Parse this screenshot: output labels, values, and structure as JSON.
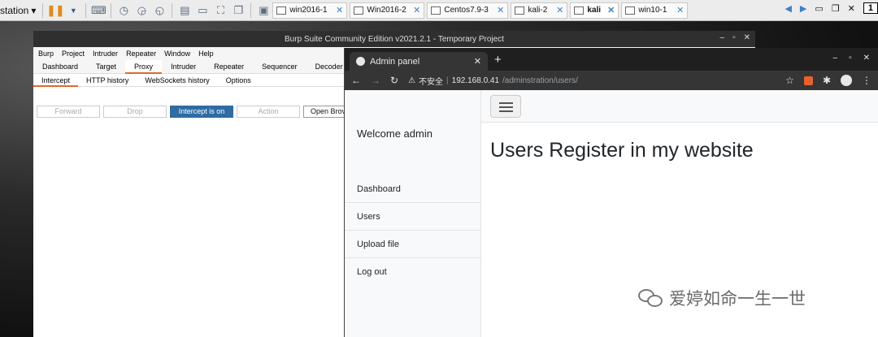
{
  "vmware": {
    "menu_label": "station",
    "tabs": [
      {
        "label": "win2016-1",
        "active": false
      },
      {
        "label": "Win2016-2",
        "active": false
      },
      {
        "label": "Centos7.9-3",
        "active": false
      },
      {
        "label": "kali-2",
        "active": false
      },
      {
        "label": "kali",
        "active": true
      },
      {
        "label": "win10-1",
        "active": false
      }
    ],
    "badge": "1"
  },
  "burp": {
    "title": "Burp Suite Community Edition v2021.2.1 - Temporary Project",
    "menu": [
      "Burp",
      "Project",
      "Intruder",
      "Repeater",
      "Window",
      "Help"
    ],
    "tabs": [
      "Dashboard",
      "Target",
      "Proxy",
      "Intruder",
      "Repeater",
      "Sequencer",
      "Decoder"
    ],
    "active_tab": "Proxy",
    "subtabs": [
      "Intercept",
      "HTTP history",
      "WebSockets history",
      "Options"
    ],
    "active_subtab": "Intercept",
    "buttons": {
      "forward": "Forward",
      "drop": "Drop",
      "intercept": "Intercept is on",
      "action": "Action",
      "open_browser": "Open Brov"
    }
  },
  "chrome": {
    "tab_title": "Admin panel",
    "security_label": "不安全",
    "url_host": "192.168.0.41",
    "url_path": "/adminstration/users/"
  },
  "page": {
    "welcome": "Welcome admin",
    "nav": [
      "Dashboard",
      "Users",
      "Upload file",
      "Log out"
    ],
    "title": "Users Register in my website"
  },
  "watermark": {
    "text": "爱婷如命一生一世"
  },
  "colors": {
    "intercept_on": "#2e6ca4",
    "burp_accent": "#e06a2b",
    "chrome_dark": "#353535"
  }
}
